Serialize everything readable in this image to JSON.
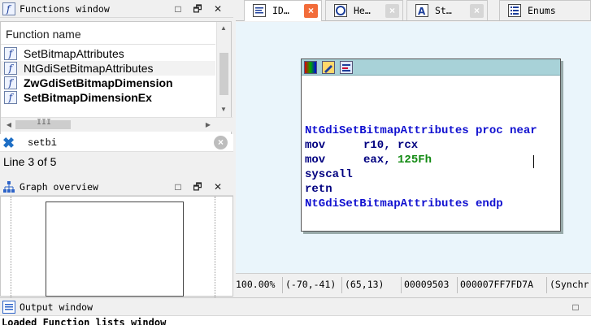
{
  "functions_window": {
    "title": "Functions window",
    "column_header": "Function name",
    "items": [
      {
        "name": "SetBitmapAttributes",
        "bold": false
      },
      {
        "name": "NtGdiSetBitmapAttributes",
        "bold": false,
        "selected": true
      },
      {
        "name": "ZwGdiSetBitmapDimension",
        "bold": true
      },
      {
        "name": "SetBitmapDimensionEx",
        "bold": true
      }
    ],
    "search_value": "setbi",
    "status": "Line 3 of 5",
    "hscroll_glyph": "III"
  },
  "graph_overview": {
    "title": "Graph overview"
  },
  "tabs": [
    {
      "label": "ID…",
      "active": true,
      "icon": "ida-view-icon"
    },
    {
      "label": "He…",
      "active": false,
      "icon": "hex-view-icon"
    },
    {
      "label": "St…",
      "active": false,
      "icon": "structures-icon"
    },
    {
      "label": "Enums",
      "active": false,
      "icon": "enums-icon"
    }
  ],
  "code": {
    "line1": "NtGdiSetBitmapAttributes proc near",
    "line2_mnem": "mov",
    "line2_ops": "r10, rcx",
    "line3_mnem": "mov",
    "line3_ops": "eax, ",
    "line3_imm": "125Fh",
    "line4": "syscall",
    "line5": "retn",
    "line6": "NtGdiSetBitmapAttributes endp"
  },
  "statusbar": {
    "zoom": "100.00%",
    "coords": "(-70,-41)",
    "pos": "(65,13)",
    "offset": "00009503",
    "address": "000007FF7FD7A",
    "sync": "(Synchr"
  },
  "output_window": {
    "title": "Output window",
    "partial_text": "Loaded Function lists window"
  },
  "window_buttons": {
    "minimize": "□",
    "restore": "🗗",
    "close": "✕"
  },
  "colors": {
    "code_blue": "#1010d0",
    "immediate_green": "#128a12",
    "node_header": "#a8d2d8",
    "active_close": "#f26c3a",
    "view_bg": "#eaf5fb"
  }
}
